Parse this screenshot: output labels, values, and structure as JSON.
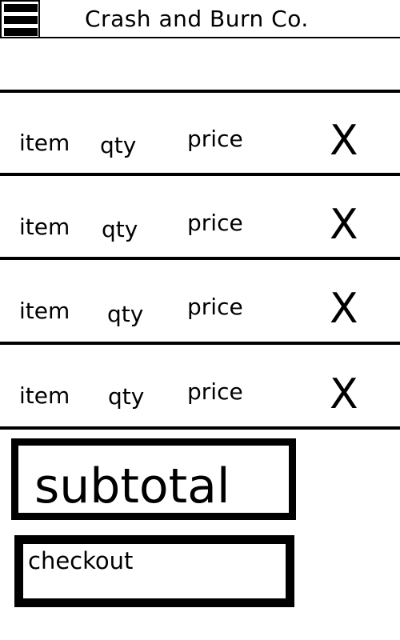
{
  "header": {
    "title": "Crash and Burn Co.",
    "menu_icon": "hamburger-menu-icon"
  },
  "cart": {
    "rows": [
      {
        "item": "item",
        "qty": "qty",
        "price": "price",
        "remove": "X"
      },
      {
        "item": "item",
        "qty": "qty",
        "price": "price",
        "remove": "X"
      },
      {
        "item": "item",
        "qty": "qty",
        "price": "price",
        "remove": "X"
      },
      {
        "item": "item",
        "qty": "qty",
        "price": "price",
        "remove": "X"
      }
    ]
  },
  "summary": {
    "subtotal_label": "subtotal"
  },
  "actions": {
    "checkout_label": "checkout"
  },
  "colors": {
    "foreground": "#000000",
    "background": "#ffffff"
  }
}
